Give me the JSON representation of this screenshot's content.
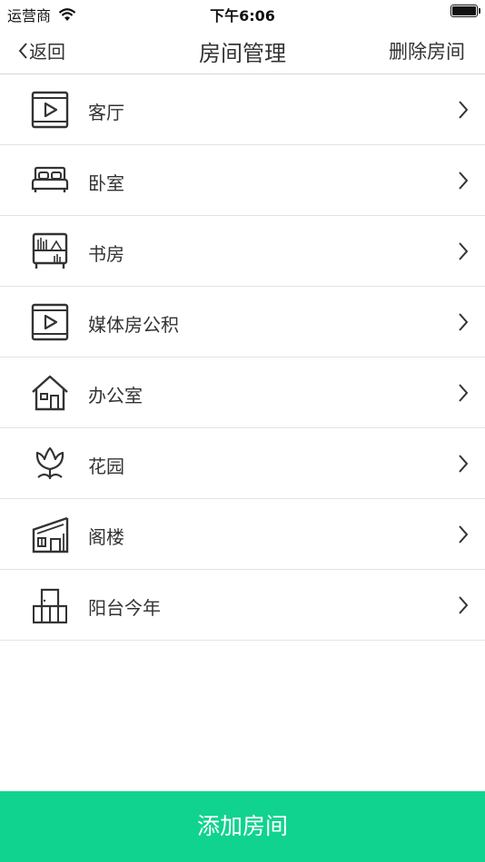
{
  "status_bar": {
    "carrier": "运营商",
    "time": "下午6:06",
    "battery_level": 1.0
  },
  "nav": {
    "back_label": "返回",
    "title": "房间管理",
    "right_action": "删除房间"
  },
  "rooms": [
    {
      "name": "客厅",
      "icon": "tv-play-icon"
    },
    {
      "name": "卧室",
      "icon": "bed-icon"
    },
    {
      "name": "书房",
      "icon": "bookshelf-icon"
    },
    {
      "name": "媒体房公积",
      "icon": "tv-play-icon"
    },
    {
      "name": "办公室",
      "icon": "house-icon"
    },
    {
      "name": "花园",
      "icon": "tulip-icon"
    },
    {
      "name": "阁楼",
      "icon": "attic-icon"
    },
    {
      "name": "阳台今年",
      "icon": "balcony-icon"
    }
  ],
  "footer": {
    "add_label": "添加房间",
    "accent_color": "#10d38f"
  }
}
